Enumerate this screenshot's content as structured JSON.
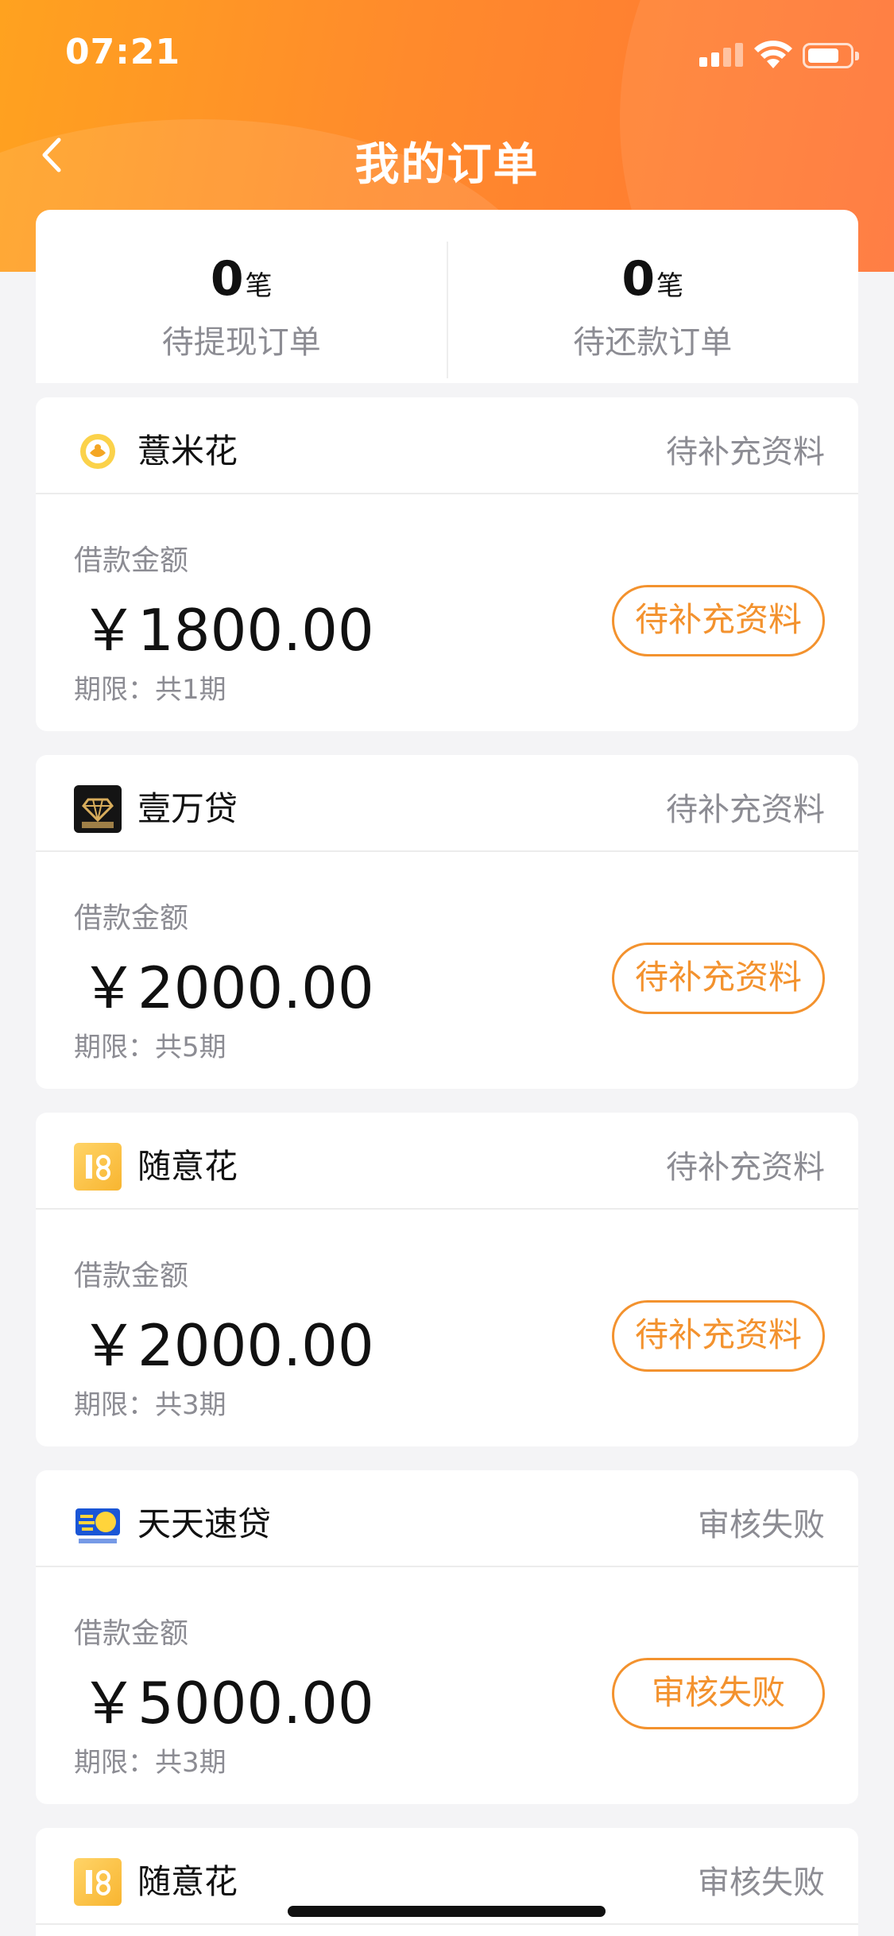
{
  "status_bar": {
    "time": "07:21"
  },
  "nav": {
    "title": "我的订单"
  },
  "summary": {
    "withdraw": {
      "count": "0",
      "unit": "笔",
      "label": "待提现订单"
    },
    "repay": {
      "count": "0",
      "unit": "笔",
      "label": "待还款订单"
    }
  },
  "orders": [
    {
      "name": "薏米花",
      "status": "待补充资料",
      "amount_label": "借款金额",
      "amount": "￥1800.00",
      "term": "期限：共1期",
      "action": "待补充资料",
      "logo": "yimihua-logo-icon"
    },
    {
      "name": "壹万贷",
      "status": "待补充资料",
      "amount_label": "借款金额",
      "amount": "￥2000.00",
      "term": "期限：共5期",
      "action": "待补充资料",
      "logo": "yiwandai-logo-icon"
    },
    {
      "name": "随意花",
      "status": "待补充资料",
      "amount_label": "借款金额",
      "amount": "￥2000.00",
      "term": "期限：共3期",
      "action": "待补充资料",
      "logo": "suiyihua-logo-icon"
    },
    {
      "name": "天天速贷",
      "status": "审核失败",
      "amount_label": "借款金额",
      "amount": "￥5000.00",
      "term": "期限：共3期",
      "action": "审核失败",
      "logo": "tiantiansudai-logo-icon"
    },
    {
      "name": "随意花",
      "status": "审核失败",
      "logo": "suiyihua-logo-icon"
    }
  ],
  "colors": {
    "accent": "#f3922e",
    "header_start": "#ffa21f",
    "header_end": "#ff7436",
    "muted_text": "#8c8c93"
  }
}
